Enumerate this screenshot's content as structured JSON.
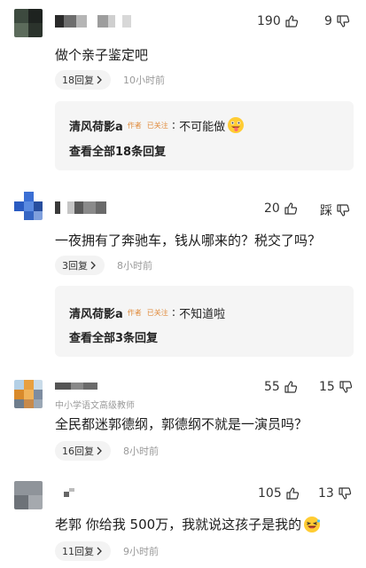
{
  "comments": [
    {
      "likes": "190",
      "dislikes": "9",
      "text": "做个亲子鉴定吧",
      "replies_label": "18回复",
      "time": "10小时前",
      "sub": {
        "author": "清风荷影a",
        "author_tag": "作者",
        "follow_tag": "已关注",
        "reply_text": "不可能做",
        "view_all": "查看全部18条回复"
      }
    },
    {
      "likes": "20",
      "dislike_label": "踩",
      "text": "一夜拥有了奔驰车，钱从哪来的？税交了吗？",
      "replies_label": "3回复",
      "time": "8小时前",
      "sub": {
        "author": "清风荷影a",
        "author_tag": "作者",
        "follow_tag": "已关注",
        "reply_text": "不知道啦",
        "view_all": "查看全部3条回复"
      }
    },
    {
      "subtitle": "中小学语文高级教师",
      "likes": "55",
      "dislikes": "15",
      "text": "全民都迷郭德纲，郭德纲不就是一演员吗？",
      "replies_label": "16回复",
      "time": "8小时前"
    },
    {
      "likes": "105",
      "dislikes": "13",
      "text": "老郭 你给我 500万，我就说这孩子是我的",
      "replies_label": "11回复",
      "time": "9小时前"
    }
  ],
  "icons": {
    "like": "thumbs-up-icon",
    "dislike": "thumbs-down-icon",
    "chevron": "chevron-right-icon",
    "emoji_tongue": "tongue-out-emoji",
    "emoji_laugh": "laughing-emoji"
  }
}
